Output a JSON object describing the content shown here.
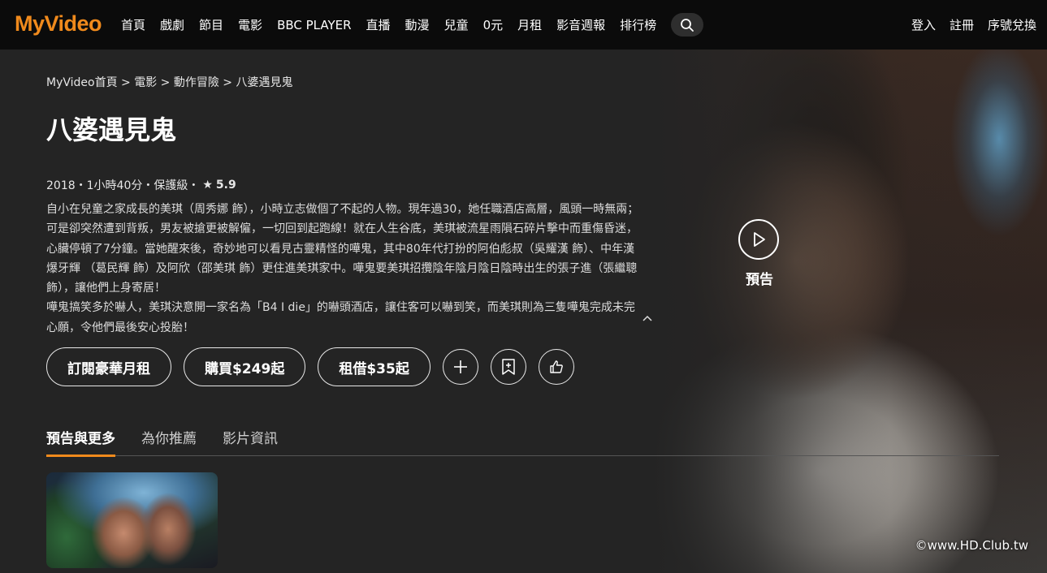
{
  "brand": {
    "logo_text": "MyVideo",
    "accent": "#f08a1c"
  },
  "nav": {
    "items": [
      "首頁",
      "戲劇",
      "節目",
      "電影",
      "BBC PLAYER",
      "直播",
      "動漫",
      "兒童",
      "0元",
      "月租",
      "影音週報",
      "排行榜"
    ],
    "right": [
      "登入",
      "註冊",
      "序號兌換"
    ]
  },
  "breadcrumb": "MyVideo首頁 > 電影 > 動作冒險 > 八婆遇見鬼",
  "movie": {
    "title": "八婆遇見鬼",
    "meta_prefix": "2018・1小時40分・保護級・",
    "star": "★",
    "rating": "5.9",
    "description": [
      "自小在兒童之家成長的美琪（周秀娜 飾），小時立志做個了不起的人物。現年過30，她任職酒店高層，風頭一時無兩；可是卻突然遭到背叛，男友被搶更被解僱，一切回到起跑線！就在人生谷底，美琪被流星雨隕石碎片擊中而重傷昏迷，心臟停頓了7分鐘。當她醒來後，奇妙地可以看見古靈精怪的嘩鬼，其中80年代打扮的阿伯彪叔（吳耀漢 飾）、中年漢爆牙輝 （葛民輝 飾）及阿欣（邵美琪 飾）更住進美琪家中。嘩鬼要美琪招攬陰年陰月陰日陰時出生的張子進（張繼聰 飾），讓他們上身寄居！",
      "嘩鬼搞笑多於嚇人，美琪決意開一家名為「B4 I die」的嚇頭酒店，讓住客可以嚇到笑，而美琪則為三隻嘩鬼完成未完心願，令他們最後安心投胎！"
    ]
  },
  "actions": {
    "subscribe": "訂閱豪華月租",
    "buy": "購買$249起",
    "rent": "租借$35起"
  },
  "trailer": {
    "label": "預告"
  },
  "tabs": [
    "預告與更多",
    "為你推薦",
    "影片資訊"
  ],
  "watermark": "©www.HD.Club.tw"
}
